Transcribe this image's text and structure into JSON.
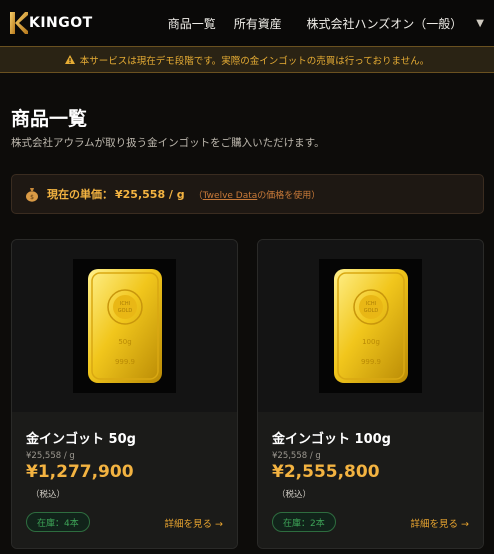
{
  "header": {
    "logo_text": "KINGOT",
    "nav": [
      "商品一覧",
      "所有資産"
    ],
    "user_name": "株式会社ハンズオン（一般）",
    "caret": "▼"
  },
  "banner": {
    "icon": "warning-icon",
    "text": "本サービスは現在デモ段階です。実際の金インゴットの売買は行っておりません。"
  },
  "page": {
    "title": "商品一覧",
    "subtitle": "株式会社アウラムが取り扱う金インゴットをご購入いただけます。"
  },
  "price": {
    "icon": "money-bag-icon",
    "label": "現在の単価：",
    "value": "¥25,558 / g",
    "note_prefix": "（",
    "note_link": "Twelve Data",
    "note_suffix": "の価格を使用）"
  },
  "products": [
    {
      "name": "金インゴット 50g",
      "unit_price": "¥25,558 / g",
      "total": "¥1,277,900",
      "tax": "（税込）",
      "stock": "在庫：4本",
      "detail": "詳細を見る →",
      "bar_text_top": "50g",
      "bar_text_bottom": "999.9"
    },
    {
      "name": "金インゴット 100g",
      "unit_price": "¥25,558 / g",
      "total": "¥2,555,800",
      "tax": "（税込）",
      "stock": "在庫：2本",
      "detail": "詳細を見る →",
      "bar_text_top": "100g",
      "bar_text_bottom": "999.9"
    }
  ],
  "colors": {
    "accent": "#f3b341",
    "background": "#0d0c0a",
    "stock_green": "#3da357",
    "banner_text": "#e6ac34"
  }
}
